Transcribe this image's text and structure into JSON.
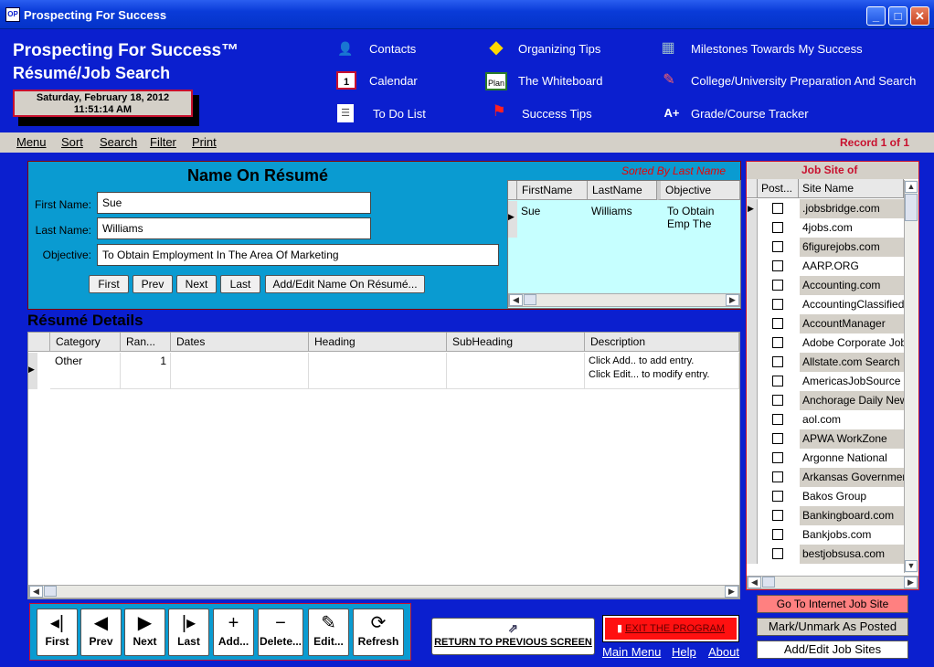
{
  "window": {
    "title": "Prospecting For Success",
    "icon_text": "OP",
    "min": "_",
    "max": "□",
    "close": "✕"
  },
  "header": {
    "app_title": "Prospecting For Success™",
    "subtitle": "Résumé/Job Search",
    "date": "Saturday, February 18, 2012",
    "time": "11:51:14 AM",
    "nav": [
      {
        "label": "Contacts",
        "icon": "contacts-icon",
        "glyph": "👤"
      },
      {
        "label": "Calendar",
        "icon": "calendar-icon",
        "glyph": "1"
      },
      {
        "label": "To Do List",
        "icon": "todo-icon",
        "glyph": "☰"
      },
      {
        "label": "Organizing Tips",
        "icon": "tips-sign-icon",
        "glyph": "◆"
      },
      {
        "label": "The Whiteboard",
        "icon": "whiteboard-icon",
        "glyph": "Plan"
      },
      {
        "label": "Success Tips",
        "icon": "flag-icon",
        "glyph": "⚑"
      },
      {
        "label": "Milestones Towards My Success",
        "icon": "map-icon",
        "glyph": "▦"
      },
      {
        "label": "College/University Preparation And Search",
        "icon": "school-icon",
        "glyph": "✎"
      },
      {
        "label": "Grade/Course Tracker",
        "icon": "grade-icon",
        "glyph": "A+"
      }
    ]
  },
  "menubar": {
    "items": [
      "Menu",
      "Sort",
      "Search",
      "Filter",
      "Print"
    ],
    "record": "Record 1 of 1"
  },
  "name_panel": {
    "heading": "Name On Résumé",
    "sorted": "Sorted By Last Name",
    "first_label": "First Name:",
    "first_value": "Sue",
    "last_label": "Last Name:",
    "last_value": "Williams",
    "objective_label": "Objective:",
    "objective_value": "To Obtain Employment In The Area Of Marketing",
    "buttons": [
      "First",
      "Prev",
      "Next",
      "Last",
      "Add/Edit Name On Résumé..."
    ],
    "grid": {
      "columns": [
        "FirstName",
        "LastName",
        "Objective"
      ],
      "row": {
        "first": "Sue",
        "last": "Williams",
        "objective": "To Obtain Emp The Area Of Ma"
      }
    }
  },
  "details": {
    "label": "Résumé Details",
    "columns": [
      "Category",
      "Ran...",
      "Dates",
      "Heading",
      "SubHeading",
      "Description"
    ],
    "row": {
      "category": "Other",
      "rank": "1",
      "dates": "",
      "heading": "",
      "subheading": "",
      "description_1": "Click Add.. to add entry.",
      "description_2": "Click Edit... to modify entry."
    }
  },
  "toolbar": {
    "buttons": [
      {
        "label": "First",
        "glyph": "◂|"
      },
      {
        "label": "Prev",
        "glyph": "◀"
      },
      {
        "label": "Next",
        "glyph": "▶"
      },
      {
        "label": "Last",
        "glyph": "|▸"
      },
      {
        "label": "Add...",
        "glyph": "+"
      },
      {
        "label": "Delete...",
        "glyph": "−"
      },
      {
        "label": "Edit...",
        "glyph": "✎"
      },
      {
        "label": "Refresh",
        "glyph": "⟳"
      }
    ],
    "return": "RETURN TO PREVIOUS SCREEN",
    "exit": "EXIT THE PROGRAM",
    "links": [
      "Main Menu",
      "Help",
      "About"
    ]
  },
  "job_sites": {
    "title": "Job Site  of",
    "columns": [
      "Post...",
      "Site Name"
    ],
    "sites": [
      ".jobsbridge.com",
      "4jobs.com",
      "6figurejobs.com",
      "AARP.ORG",
      "Accounting.com",
      "AccountingClassifieds",
      "AccountManager",
      "Adobe Corporate Jobs",
      "Allstate.com Search",
      "AmericasJobSource",
      "Anchorage Daily News",
      "aol.com",
      "APWA WorkZone",
      "Argonne National",
      "Arkansas Government",
      "Bakos Group",
      "Bankingboard.com",
      "Bankjobs.com",
      "bestjobsusa.com"
    ],
    "buttons": [
      "Go To Internet Job Site",
      "Mark/Unmark As Posted",
      "Add/Edit Job Sites"
    ]
  }
}
